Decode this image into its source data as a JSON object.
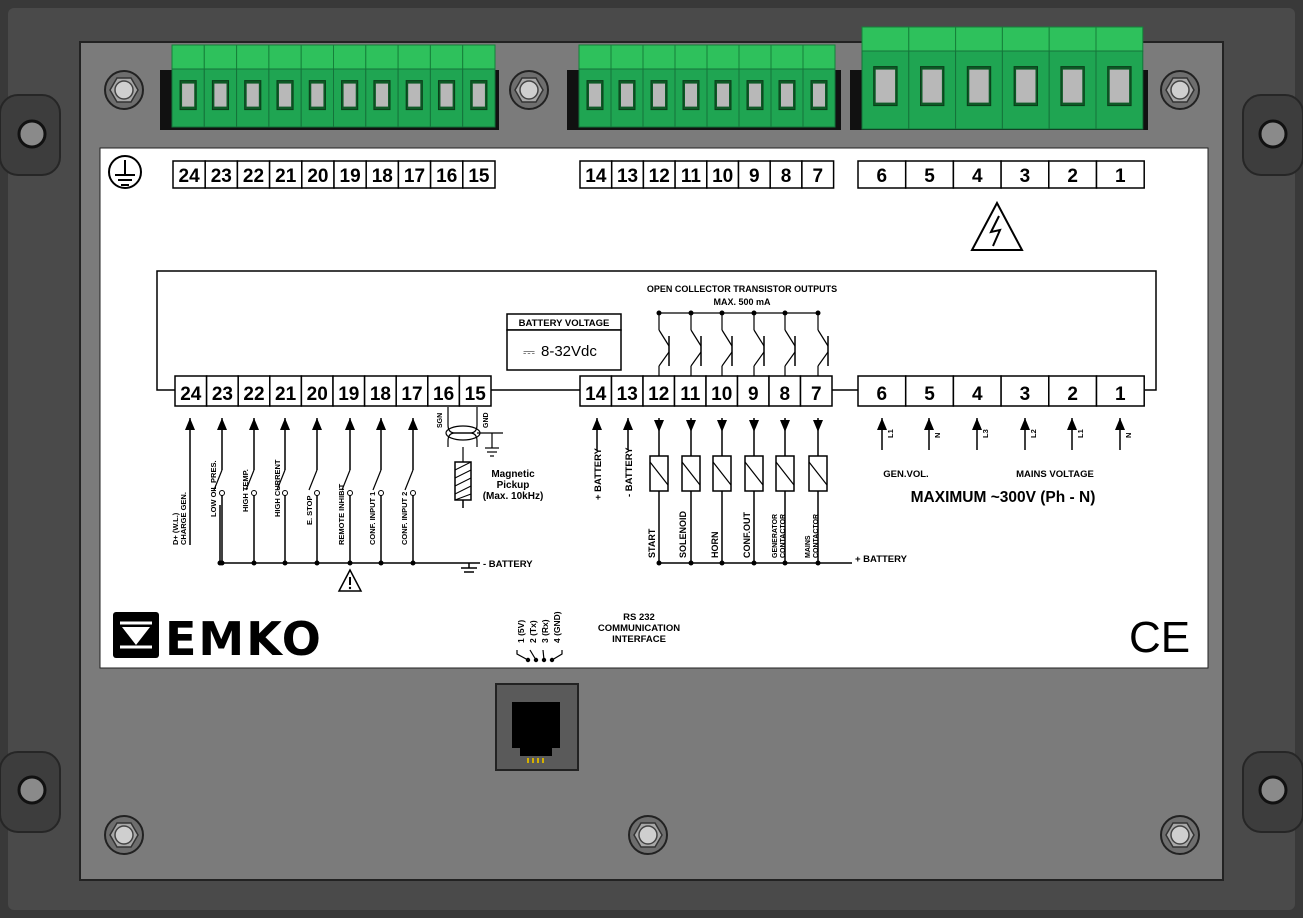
{
  "top_labels_left": [
    "24",
    "23",
    "22",
    "21",
    "20",
    "19",
    "18",
    "17",
    "16",
    "15"
  ],
  "top_labels_mid": [
    "14",
    "13",
    "12",
    "11",
    "10",
    "9",
    "8",
    "7"
  ],
  "top_labels_right": [
    "6",
    "5",
    "4",
    "3",
    "2",
    "1"
  ],
  "row_left": [
    "24",
    "23",
    "22",
    "21",
    "20",
    "19",
    "18",
    "17",
    "16",
    "15"
  ],
  "row_mid": [
    "14",
    "13",
    "12",
    "11",
    "10",
    "9",
    "8",
    "7"
  ],
  "row_right": [
    "6",
    "5",
    "4",
    "3",
    "2",
    "1"
  ],
  "transistor_title": "OPEN COLLECTOR TRANSISTOR OUTPUTS",
  "transistor_max": "MAX. 500 mA",
  "battery_voltage_title": "BATTERY VOLTAGE",
  "battery_voltage_value": "8-32Vdc",
  "dc_symbol": "⎓",
  "left_inputs": [
    "D+ (W.L.)",
    "CHARGE GEN.",
    "LOW OIL PRES.",
    "HIGH TEMP.",
    "HIGH CURRENT",
    "E. STOP",
    "REMOTE INHIBIT",
    "CONF. INPUT 1",
    "CONF. INPUT 2"
  ],
  "sgn": "SGN",
  "gnd": "GND",
  "magnetic_pickup": [
    "Magnetic",
    "Pickup",
    "(Max. 10kHz)"
  ],
  "neg_battery": "- BATTERY",
  "plus_battery_left": "+ BATTERY",
  "minus_battery_vert": "- BATTERY",
  "outputs": [
    "START",
    "SOLENOID",
    "HORN",
    "CONF.OUT",
    "GENERATOR CONTACTOR",
    "MAINS CONTACTOR"
  ],
  "plus_battery_right": "+ BATTERY",
  "phase_labels": [
    "L1",
    "N",
    "L3",
    "L2",
    "L1",
    "N"
  ],
  "gen_vol": "GEN.VOL.",
  "mains_voltage": "MAINS VOLTAGE",
  "maximum": "MAXIMUM  ~300V (Ph - N)",
  "brand": "EMKO",
  "ce": "CE",
  "rs232_title": [
    "RS 232",
    "COMMUNICATION",
    "INTERFACE"
  ],
  "rs232_pins": [
    "1 (5V)",
    "2 (Tx)",
    "3 (Rx)",
    "4 (GND)"
  ]
}
